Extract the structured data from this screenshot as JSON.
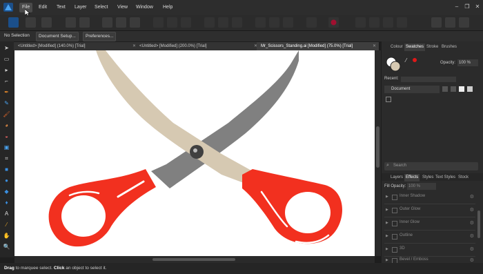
{
  "menu": {
    "items": [
      "File",
      "Edit",
      "Text",
      "Layer",
      "Select",
      "View",
      "Window",
      "Help"
    ]
  },
  "context_bar": {
    "selection": "No Selection",
    "doc_setup": "Document Setup...",
    "prefs": "Preferences..."
  },
  "tabs": [
    {
      "title": "<Untitled> [Modified] (140.0%) [Trial]"
    },
    {
      "title": "<Untitled> [Modified] (200.0%) [Trial]"
    },
    {
      "title": "Mr_Scissors_Standing.ai [Modified] (75.0%) [Trial]"
    }
  ],
  "status": {
    "drag": "Drag",
    "drag_text": " to marquee select. ",
    "click": "Click",
    "click_text": " an object to select it."
  },
  "right_panel": {
    "top_tabs": [
      "Colour",
      "Swatches",
      "Stroke",
      "Brushes"
    ],
    "opacity_label": "Opacity:",
    "opacity_value": "100 %",
    "recent_label": "Recent:",
    "document_select": "Document",
    "search_placeholder": "Search",
    "lower_tabs": [
      "Layers",
      "Effects",
      "Styles",
      "Text Styles",
      "Stock"
    ],
    "fill_opacity_label": "Fill Opacity:",
    "fill_opacity_value": "100 %",
    "effects": [
      "Inner Shadow",
      "Outer Glow",
      "Inner Glow",
      "Outline",
      "3D",
      "Bevel / Emboss"
    ]
  },
  "colors": {
    "accent": "#2d8fdd",
    "scissor_handle": "#f2301f",
    "blade_light": "#d6c9b2",
    "blade_dark": "#808080"
  }
}
